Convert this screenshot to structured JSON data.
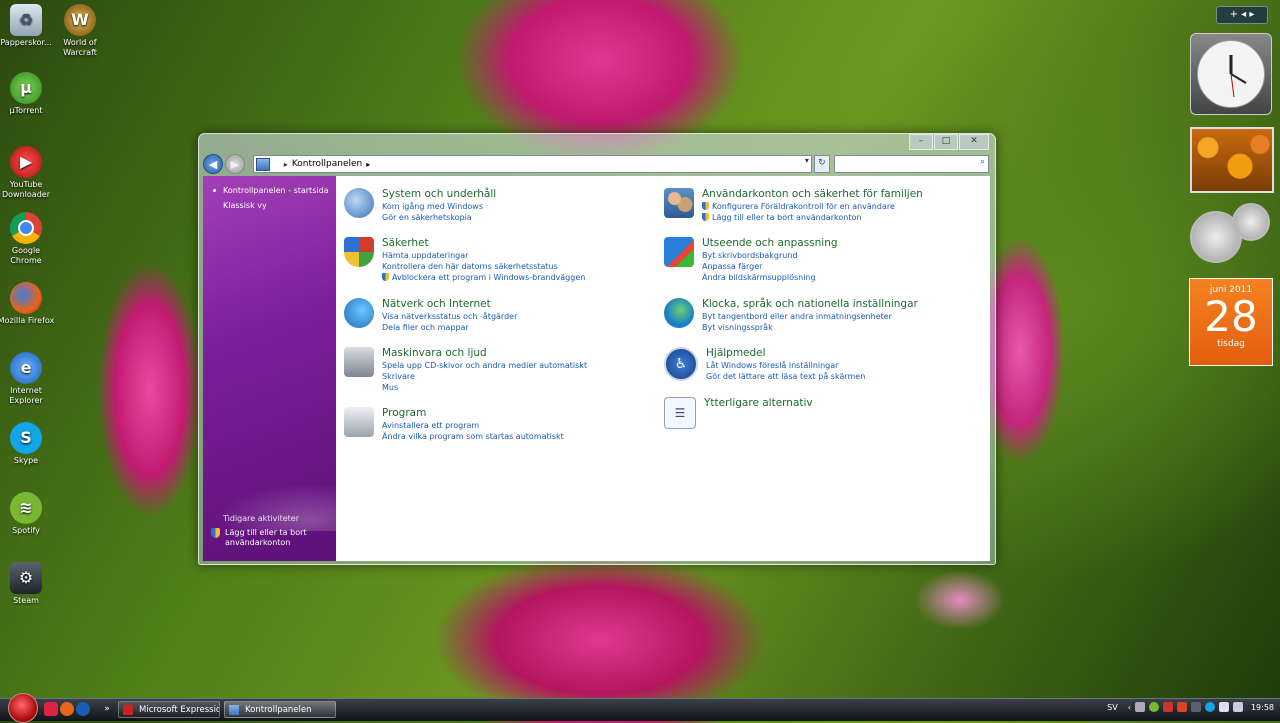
{
  "desktop": {
    "icons": [
      {
        "label": "Papperskor...",
        "icon": "recycle-bin-icon"
      },
      {
        "label": "World of Warcraft",
        "icon": "wow-icon"
      },
      {
        "label": "µTorrent",
        "icon": "utorrent-icon"
      },
      {
        "label": "YouTube Downloader",
        "icon": "youtube-downloader-icon"
      },
      {
        "label": "Google Chrome",
        "icon": "chrome-icon"
      },
      {
        "label": "Mozilla Firefox",
        "icon": "firefox-icon"
      },
      {
        "label": "Internet Explorer",
        "icon": "ie-icon"
      },
      {
        "label": "Skype",
        "icon": "skype-icon"
      },
      {
        "label": "Spotify",
        "icon": "spotify-icon"
      },
      {
        "label": "Steam",
        "icon": "steam-icon"
      }
    ]
  },
  "gadgets": {
    "calendar": {
      "month": "juni 2011",
      "day": "28",
      "weekday": "tisdag"
    }
  },
  "window": {
    "address": {
      "crumb": "Kontrollpanelen",
      "placeholder": ""
    },
    "sidebar": {
      "items": [
        "Kontrollpanelen - startsida",
        "Klassisk vy"
      ],
      "recent_heading": "Tidigare aktiviteter",
      "recent_items": [
        "Lägg till eller ta bort användarkonton"
      ]
    },
    "categories_left": [
      {
        "title": "System och underhåll",
        "links": [
          "Kom igång med Windows",
          "Gör en säkerhetskopia"
        ],
        "icon": "system-icon"
      },
      {
        "title": "Säkerhet",
        "links": [
          "Hämta uppdateringar",
          "Kontrollera den här datorns säkerhetsstatus",
          "Avblockera ett program i Windows-brandväggen"
        ],
        "icon": "security-shield-icon"
      },
      {
        "title": "Nätverk och Internet",
        "links": [
          "Visa nätverksstatus och -åtgärder",
          "Dela filer och mappar"
        ],
        "icon": "network-icon"
      },
      {
        "title": "Maskinvara och ljud",
        "links": [
          "Spela upp CD-skivor och andra medier automatiskt",
          "Skrivare",
          "Mus"
        ],
        "icon": "hardware-icon"
      },
      {
        "title": "Program",
        "links": [
          "Avinstallera ett program",
          "Ändra vilka program som startas automatiskt"
        ],
        "icon": "programs-icon"
      }
    ],
    "categories_right": [
      {
        "title": "Användarkonton och säkerhet för familjen",
        "links": [
          "Konfigurera Föräldrakontroll för en användare",
          "Lägg till eller ta bort användarkonton"
        ],
        "icon": "user-accounts-icon"
      },
      {
        "title": "Utseende och anpassning",
        "links": [
          "Byt skrivbordsbakgrund",
          "Anpassa färger",
          "Ändra bildskärmsupplösning"
        ],
        "icon": "appearance-icon"
      },
      {
        "title": "Klocka, språk och nationella inställningar",
        "links": [
          "Byt tangentbord eller andra inmatningsenheter",
          "Byt visningsspråk"
        ],
        "icon": "clock-globe-icon"
      },
      {
        "title": "Hjälpmedel",
        "links": [
          "Låt Windows föreslå inställningar",
          "Gör det lättare att läsa text på skärmen"
        ],
        "icon": "accessibility-icon"
      },
      {
        "title": "Ytterligare alternativ",
        "links": [],
        "icon": "additional-options-icon"
      }
    ]
  },
  "taskbar": {
    "buttons": [
      {
        "label": "Microsoft Expressio..."
      },
      {
        "label": "Kontrollpanelen"
      }
    ],
    "tray": {
      "lang": "SV",
      "time": "19:58"
    }
  }
}
